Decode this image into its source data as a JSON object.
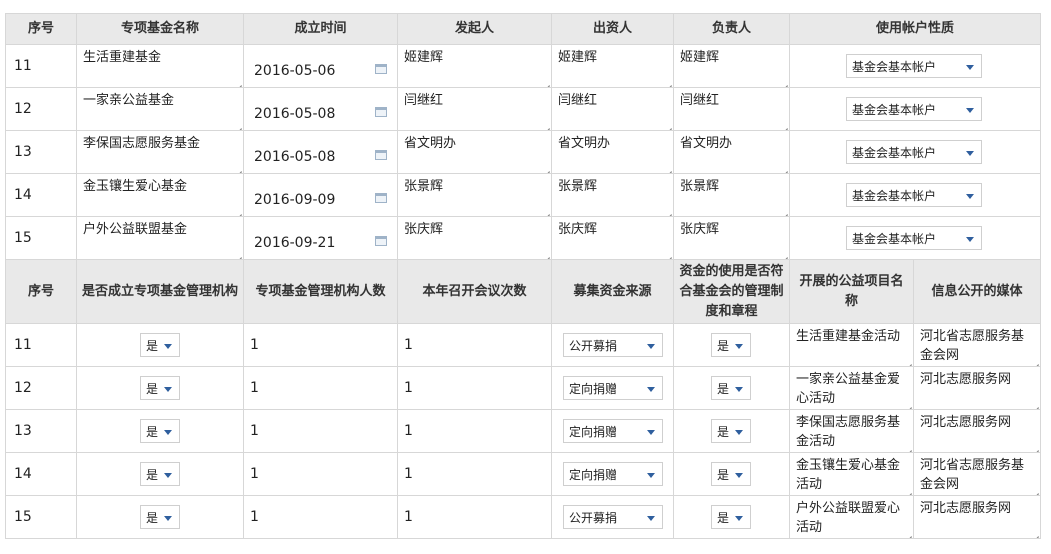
{
  "table1": {
    "headers": [
      "序号",
      "专项基金名称",
      "成立时间",
      "发起人",
      "出资人",
      "负责人",
      "使用帐户性质"
    ],
    "rows": [
      {
        "no": "11",
        "name": "生活重建基金",
        "date": "2016-05-06",
        "initiator": "姬建辉",
        "investor": "姬建辉",
        "manager": "姬建辉",
        "account": "基金会基本帐户"
      },
      {
        "no": "12",
        "name": "一家亲公益基金",
        "date": "2016-05-08",
        "initiator": "闫继红",
        "investor": "闫继红",
        "manager": "闫继红",
        "account": "基金会基本帐户"
      },
      {
        "no": "13",
        "name": "李保国志愿服务基金",
        "date": "2016-05-08",
        "initiator": "省文明办",
        "investor": "省文明办",
        "manager": "省文明办",
        "account": "基金会基本帐户"
      },
      {
        "no": "14",
        "name": "金玉镶生爱心基金",
        "date": "2016-09-09",
        "initiator": "张景辉",
        "investor": "张景辉",
        "manager": "张景辉",
        "account": "基金会基本帐户"
      },
      {
        "no": "15",
        "name": "户外公益联盟基金",
        "date": "2016-09-21",
        "initiator": "张庆辉",
        "investor": "张庆辉",
        "manager": "张庆辉",
        "account": "基金会基本帐户"
      }
    ]
  },
  "table2": {
    "headers": [
      "序号",
      "是否成立专项基金管理机构",
      "专项基金管理机构人数",
      "本年召开会议次数",
      "募集资金来源",
      "资金的使用是否符合基金会的管理制度和章程",
      "开展的公益项目名称",
      "信息公开的媒体"
    ],
    "rows": [
      {
        "no": "11",
        "has_org": "是",
        "staff": "1",
        "meetings": "1",
        "source": "公开募捐",
        "compliant": "是",
        "project": "生活重建基金活动",
        "media": "河北省志愿服务基金会网"
      },
      {
        "no": "12",
        "has_org": "是",
        "staff": "1",
        "meetings": "1",
        "source": "定向捐赠",
        "compliant": "是",
        "project": "一家亲公益基金爱心活动",
        "media": "河北志愿服务网"
      },
      {
        "no": "13",
        "has_org": "是",
        "staff": "1",
        "meetings": "1",
        "source": "定向捐赠",
        "compliant": "是",
        "project": "李保国志愿服务基金活动",
        "media": "河北志愿服务网"
      },
      {
        "no": "14",
        "has_org": "是",
        "staff": "1",
        "meetings": "1",
        "source": "定向捐赠",
        "compliant": "是",
        "project": "金玉镶生爱心基金活动",
        "media": "河北省志愿服务基金会网"
      },
      {
        "no": "15",
        "has_org": "是",
        "staff": "1",
        "meetings": "1",
        "source": "公开募捐",
        "compliant": "是",
        "project": "户外公益联盟爱心活动",
        "media": "河北志愿服务网"
      }
    ]
  },
  "icons": {
    "date_picker": "calendar-icon",
    "dropdown": "chevron-down-icon",
    "resize": "resize-grip-icon"
  },
  "colors": {
    "header_bg": "#e9e9e9",
    "grid": "#d7d7d7",
    "dropdown_arrow": "#2f5f9e"
  }
}
